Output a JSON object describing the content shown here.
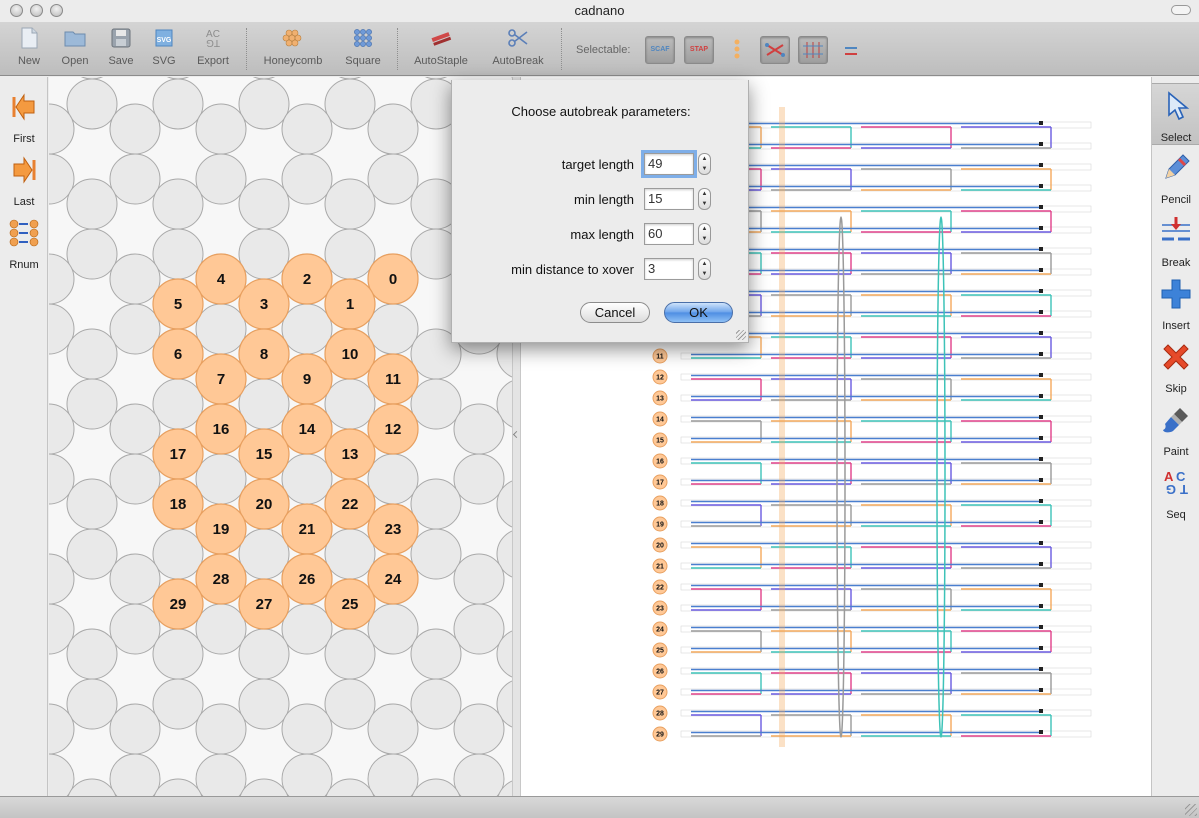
{
  "window": {
    "title": "cadnano"
  },
  "toolbar": {
    "new": "New",
    "open": "Open",
    "save": "Save",
    "svg": "SVG",
    "export": "Export",
    "honeycomb": "Honeycomb",
    "square": "Square",
    "autostaple": "AutoStaple",
    "autobreak": "AutoBreak",
    "selectable_label": "Selectable:",
    "scaf": "SCAF",
    "stap": "STAP"
  },
  "left_tools": {
    "first": "First",
    "last": "Last",
    "rnum": "Rnum"
  },
  "right_tools": {
    "select": "Select",
    "pencil": "Pencil",
    "break": "Break",
    "insert": "Insert",
    "skip": "Skip",
    "paint": "Paint",
    "seq": "Seq"
  },
  "dialog": {
    "title": "Choose autobreak parameters:",
    "fields": [
      {
        "label": "target length",
        "value": "49"
      },
      {
        "label": "min length",
        "value": "15"
      },
      {
        "label": "max length",
        "value": "60"
      },
      {
        "label": "min distance to xover",
        "value": "3"
      }
    ],
    "cancel": "Cancel",
    "ok": "OK"
  },
  "slice": {
    "helices": [
      "4",
      "2",
      "0",
      "5",
      "3",
      "1",
      "6",
      "8",
      "10",
      "7",
      "9",
      "11",
      "16",
      "14",
      "12",
      "17",
      "15",
      "13",
      "18",
      "20",
      "22",
      "19",
      "21",
      "23",
      "28",
      "26",
      "24",
      "29",
      "27",
      "25"
    ]
  },
  "path": {
    "visible_helix_numbers": [
      "11",
      "12",
      "13",
      "14",
      "15",
      "16",
      "17",
      "18",
      "19",
      "20",
      "21",
      "22",
      "23",
      "24",
      "25",
      "26",
      "27",
      "28",
      "29"
    ]
  },
  "colors": {
    "helix_fill": "#ffc896",
    "helix_stroke": "#e8a060",
    "empty_fill": "#e9e9e9",
    "empty_stroke": "#a9a9a9",
    "scaffold": "#4a7fcf",
    "staple_orange": "#f4a95c",
    "staple_teal": "#3dc3b8",
    "staple_pink": "#e0408a",
    "staple_purple": "#6a5ae0",
    "staple_gray": "#9a9a9a"
  }
}
